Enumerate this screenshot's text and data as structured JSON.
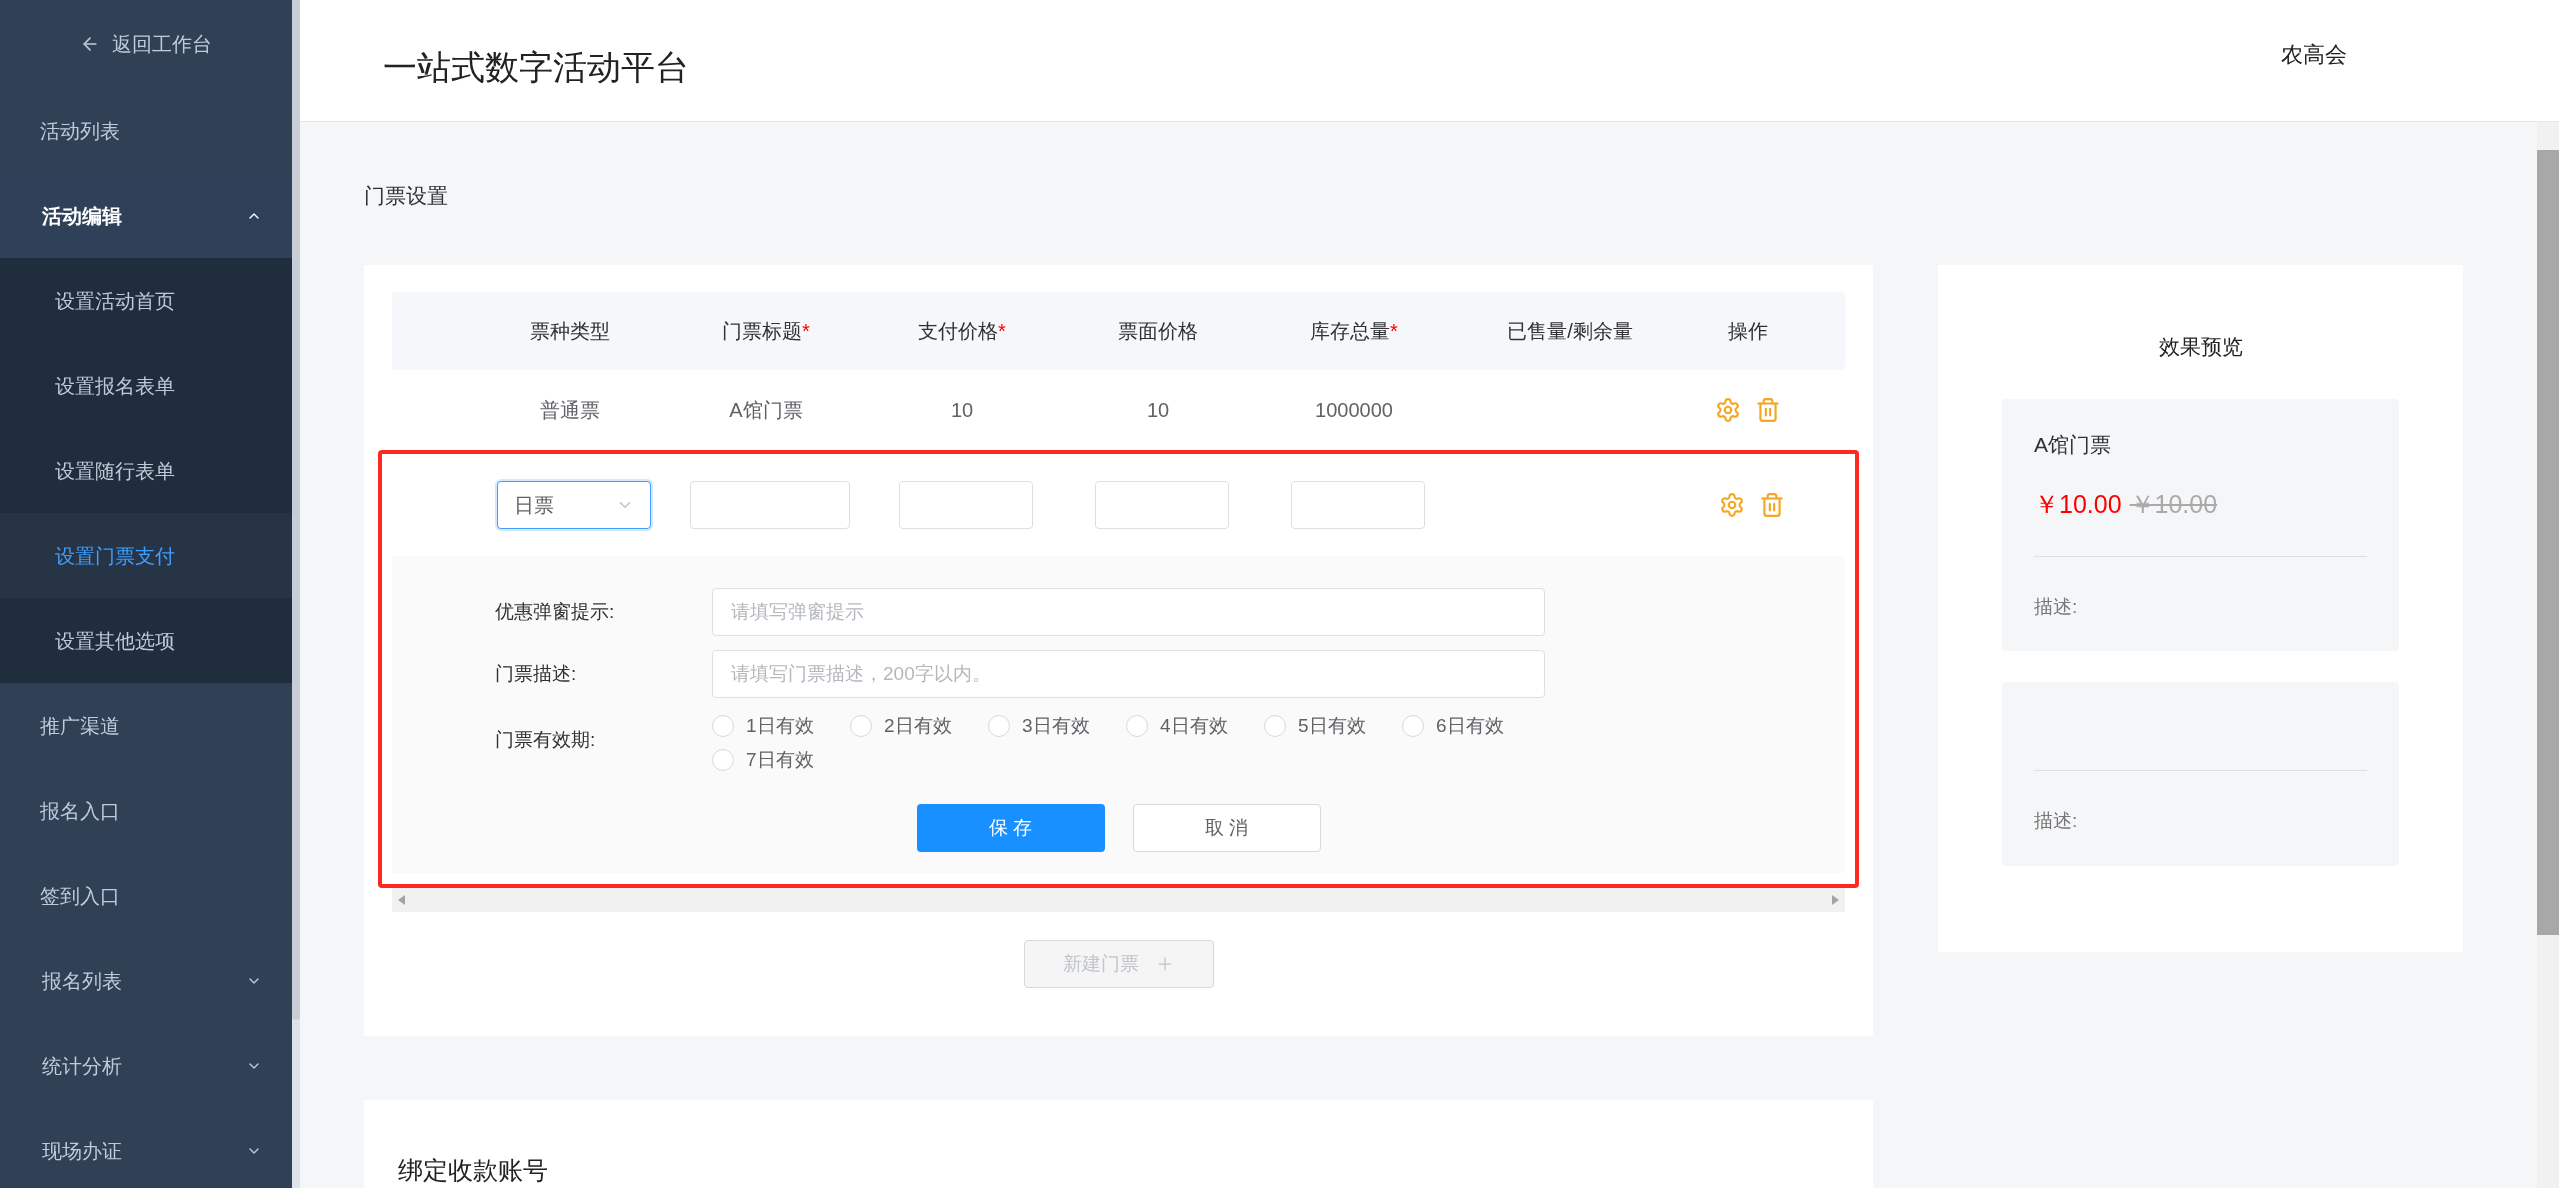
{
  "sidebar": {
    "back": "返回工作台",
    "items": [
      {
        "label": "活动列表",
        "kind": "link"
      },
      {
        "label": "活动编辑",
        "kind": "group",
        "expanded": true,
        "children": [
          {
            "label": "设置活动首页",
            "selected": false
          },
          {
            "label": "设置报名表单",
            "selected": false
          },
          {
            "label": "设置随行表单",
            "selected": false
          },
          {
            "label": "设置门票支付",
            "selected": true
          },
          {
            "label": "设置其他选项",
            "selected": false
          }
        ]
      },
      {
        "label": "推广渠道",
        "kind": "link"
      },
      {
        "label": "报名入口",
        "kind": "link"
      },
      {
        "label": "签到入口",
        "kind": "link"
      },
      {
        "label": "报名列表",
        "kind": "group",
        "expanded": false
      },
      {
        "label": "统计分析",
        "kind": "group",
        "expanded": false
      },
      {
        "label": "现场办证",
        "kind": "group",
        "expanded": false
      }
    ]
  },
  "header": {
    "title": "一站式数字活动平台",
    "user": "农高会"
  },
  "section_title": "门票设置",
  "table": {
    "columns": [
      {
        "label": "票种类型"
      },
      {
        "label": "门票标题",
        "mark": "*"
      },
      {
        "label": "支付价格",
        "mark": "*"
      },
      {
        "label": "票面价格"
      },
      {
        "label": "库存总量",
        "mark": "*"
      },
      {
        "label": "已售量/剩余量"
      },
      {
        "label": "操作"
      }
    ],
    "rows": [
      {
        "cells": [
          "普通票",
          "A馆门票",
          "10",
          "10",
          "1000000"
        ]
      }
    ]
  },
  "editor": {
    "highlighted": true,
    "ticket_type": "日票",
    "fields": [
      {
        "label": "优惠弹窗提示:",
        "placeholder": "请填写弹窗提示"
      },
      {
        "label": "门票描述:",
        "placeholder": "请填写门票描述，200字以内。"
      }
    ],
    "validity": {
      "label": "门票有效期:",
      "options": [
        {
          "label": "1日有效",
          "selected": false
        },
        {
          "label": "2日有效",
          "selected": false
        },
        {
          "label": "3日有效",
          "selected": false
        },
        {
          "label": "4日有效",
          "selected": false
        },
        {
          "label": "5日有效",
          "selected": false
        },
        {
          "label": "6日有效",
          "selected": false
        },
        {
          "label": "7日有效",
          "selected": false
        }
      ]
    },
    "buttons": [
      {
        "label": "保 存",
        "kind": "primary"
      },
      {
        "label": "取 消",
        "kind": "default"
      }
    ]
  },
  "new_ticket": {
    "label": "新建门票",
    "disabled": true
  },
  "preview": {
    "title": "效果预览",
    "cards": [
      {
        "title": "A馆门票",
        "price": "￥10.00",
        "original_price": "￥10.00",
        "desc_label": "描述:"
      },
      {
        "desc_label": "描述:"
      }
    ]
  },
  "account_section": {
    "title": "绑定收款账号"
  }
}
